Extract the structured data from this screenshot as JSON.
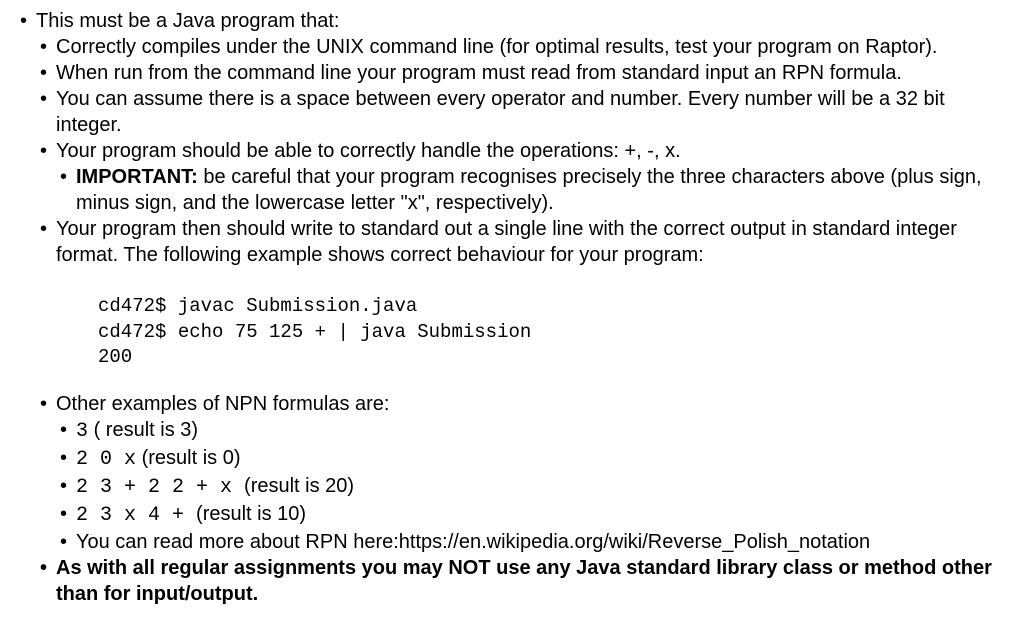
{
  "content": {
    "item1": "This must be a Java program that:",
    "item1_1": "Correctly compiles under the UNIX command line (for optimal results, test your program on Raptor).",
    "item1_2": "When run from the command line your program must read from standard input an  RPN formula.",
    "item1_3": "You can assume there is a space between every operator and number.  Every number will be a 32 bit integer.",
    "item1_4": "Your program should be able to correctly handle the operations: +, -, x.",
    "item1_4_1_label": "IMPORTANT:",
    "item1_4_1_text": " be careful that your program recognises precisely the three characters above (plus sign, minus sign, and the lowercase letter \"x\", respectively).",
    "item1_5": "Your program then should write to standard out a single line with the correct output in standard integer format. The following example shows correct behaviour for your program:",
    "code": "cd472$ javac Submission.java\ncd472$ echo 75 125 + | java Submission\n200",
    "item1_6": "Other examples of NPN formulas are:",
    "ex1_code": "3",
    "ex1_res": " ( result is 3)",
    "ex2_code": "2  0 x",
    "ex2_res": " (result is 0)",
    "ex3_code": "2  3  +  2  2  +  x  ",
    "ex3_res": " (result is 20)",
    "ex4_code": "2  3  x  4  +  ",
    "ex4_res": " (result is 10)",
    "item1_6_5": "You can read more about RPN here:https://en.wikipedia.org/wiki/Reverse_Polish_notation",
    "item1_7": "As with all regular assignments you may NOT use any Java standard library class or method other than for input/output."
  }
}
